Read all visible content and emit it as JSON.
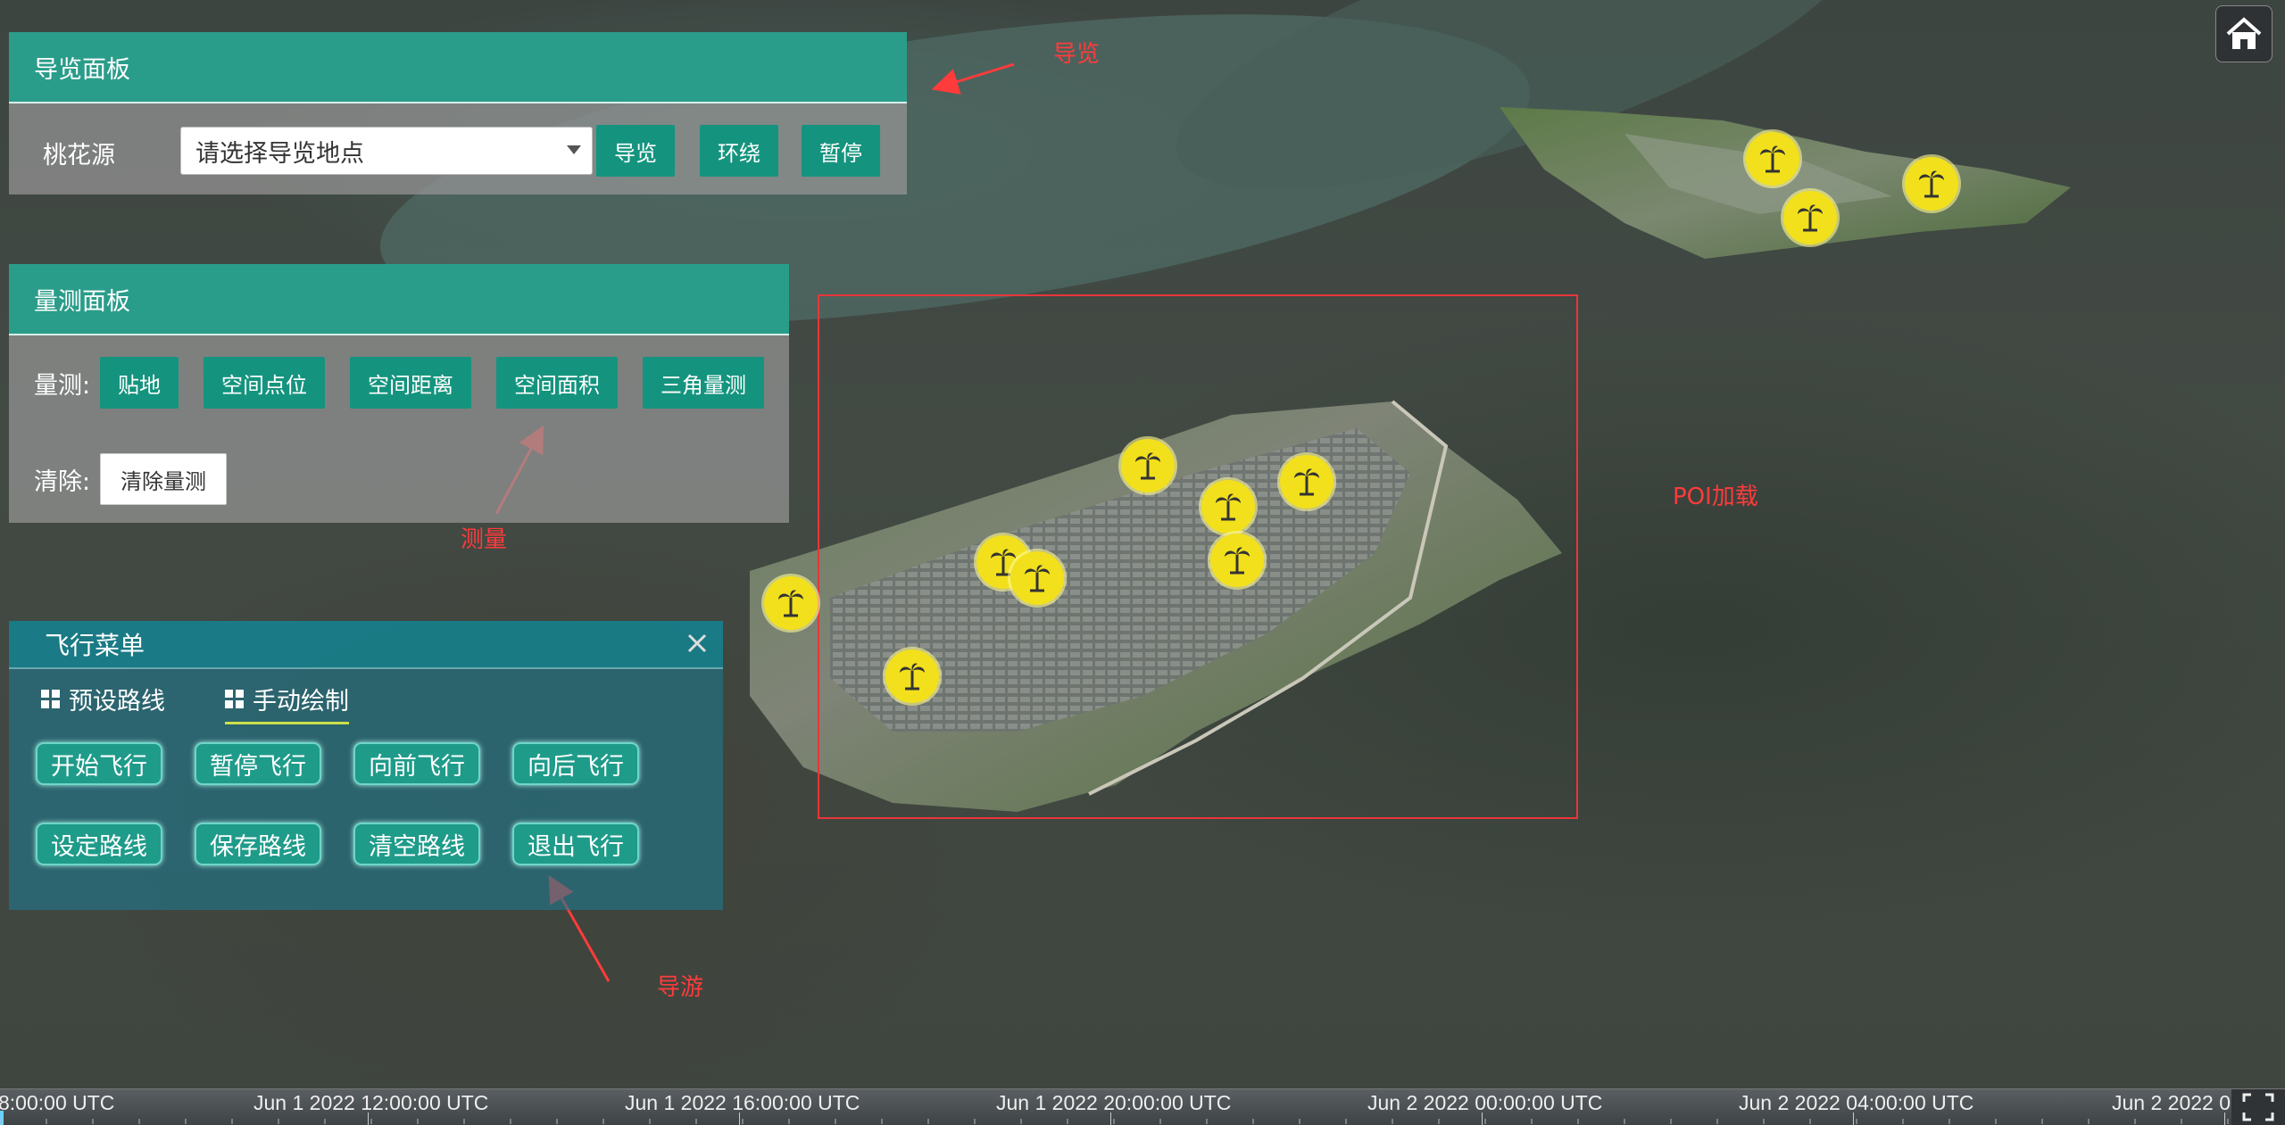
{
  "guide_panel": {
    "title": "导览面板",
    "label": "桃花源",
    "select_placeholder": "请选择导览地点",
    "buttons": [
      "导览",
      "环绕",
      "暂停"
    ]
  },
  "measure_panel": {
    "title": "量测面板",
    "measure_label": "量测:",
    "buttons": [
      "贴地",
      "空间点位",
      "空间距离",
      "空间面积",
      "三角量测"
    ],
    "clear_label": "清除:",
    "clear_button": "清除量测"
  },
  "flight_menu": {
    "title": "飞行菜单",
    "close_icon": "close-icon",
    "tabs": [
      "预设路线",
      "手动绘制"
    ],
    "active_tab": "手动绘制",
    "row1": [
      "开始飞行",
      "暂停飞行",
      "向前飞行",
      "向后飞行"
    ],
    "row2": [
      "设定路线",
      "保存路线",
      "清空路线",
      "退出飞行"
    ]
  },
  "annotations": {
    "guide": "导览",
    "measure": "测量",
    "tour": "导游",
    "poi": "POI加载"
  },
  "annotation_color": "#ff3b3b",
  "accent_color": "#14947e",
  "poi_icon": "palm-tree-icon",
  "home_icon": "home-icon",
  "timeline": {
    "labels": [
      "8:00:00 UTC",
      "Jun 1 2022 12:00:00 UTC",
      "Jun 1 2022 16:00:00 UTC",
      "Jun 1 2022 20:00:00 UTC",
      "Jun 2 2022 00:00:00 UTC",
      "Jun 2 2022 04:00:00 UTC",
      "Jun 2 2022 0"
    ]
  }
}
